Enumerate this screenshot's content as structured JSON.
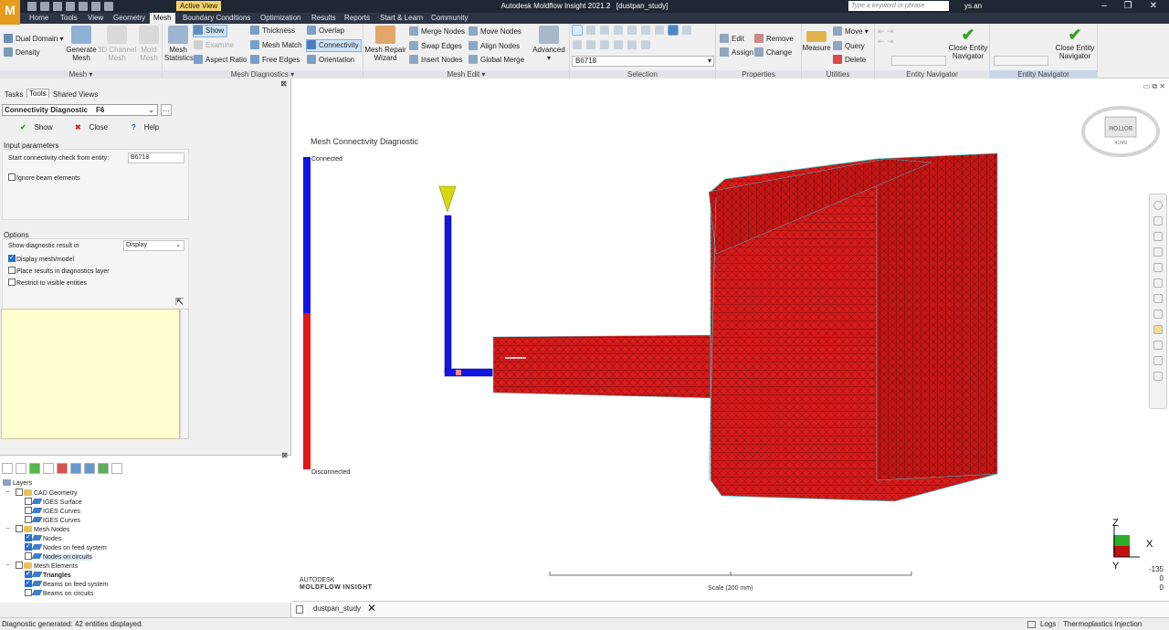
{
  "titlebar": {
    "app_title": "Autodesk Moldflow Insight 2021.2",
    "doc_title": "[dustpan_study]",
    "active_view": "Active View",
    "search_placeholder": "Type a keyword or phrase",
    "user": "ys.an"
  },
  "tabs": [
    "Home",
    "Tools",
    "View",
    "Geometry",
    "Mesh",
    "Boundary Conditions",
    "Optimization",
    "Results",
    "Reports",
    "Start & Learn",
    "Community"
  ],
  "ribbon": {
    "mesh_group": {
      "dual_domain": "Dual Domain",
      "density": "Density",
      "generate_mesh": "Generate Mesh",
      "channel_mesh": "3D Channel Mesh",
      "mold_mesh": "Mold Mesh",
      "label": "Mesh"
    },
    "diag_group": {
      "mesh_statistics": "Mesh Statistics",
      "show": "Show",
      "examine": "Examine",
      "aspect_ratio": "Aspect Ratio",
      "thickness": "Thickness",
      "mesh_match": "Mesh Match",
      "free_edges": "Free Edges",
      "overlap": "Overlap",
      "connectivity": "Connectivity",
      "orientation": "Orientation",
      "label": "Mesh Diagnostics"
    },
    "edit_group": {
      "mesh_repair_wizard": "Mesh Repair Wizard",
      "merge_nodes": "Merge Nodes",
      "swap_edges": "Swap Edges",
      "insert_nodes": "Insert Nodes",
      "move_nodes": "Move Nodes",
      "align_nodes": "Align Nodes",
      "global_merge": "Global Merge",
      "advanced": "Advanced",
      "label": "Mesh Edit"
    },
    "selection_group": {
      "entity_value": "B6718",
      "label": "Selection"
    },
    "properties_group": {
      "edit": "Edit",
      "assign": "Assign",
      "remove": "Remove",
      "change": "Change",
      "label": "Properties"
    },
    "utilities_group": {
      "measure": "Measure",
      "move": "Move",
      "query": "Query",
      "delete": "Delete",
      "label": "Utilities"
    },
    "nav1": {
      "close": "Close Entity Navigator",
      "label": "Entity Navigator"
    },
    "nav2": {
      "close": "Close Entity Navigator",
      "label": "Entity Navigator"
    }
  },
  "left_panel": {
    "tabs": [
      "Tasks",
      "Tools",
      "Shared Views"
    ],
    "tool_name": "Connectivity Diagnostic",
    "tool_key": "F6",
    "show": "Show",
    "close": "Close",
    "help": "Help",
    "input_parameters": "Input parameters",
    "start_from_label": "Start connectivity check from entity:",
    "start_from_value": "B6718",
    "ignore_beams": "Ignore beam elements",
    "options": "Options",
    "show_result_label": "Show diagnostic result in",
    "show_result_value": "Display",
    "display_mesh": "Display mesh/model",
    "place_results": "Place results in diagnostics layer",
    "restrict_visible": "Restrict to visible entities"
  },
  "layers": {
    "root": "Layers",
    "groups": [
      {
        "name": "CAD Geometry",
        "items": [
          {
            "name": "IGES Surface",
            "checked": false
          },
          {
            "name": "IGES Curves",
            "checked": false
          },
          {
            "name": "IGES Curves",
            "checked": false
          }
        ]
      },
      {
        "name": "Mesh Nodes",
        "items": [
          {
            "name": "Nodes",
            "checked": true
          },
          {
            "name": "Nodes on feed system",
            "checked": true
          },
          {
            "name": "Nodes on circuits",
            "checked": false
          }
        ]
      },
      {
        "name": "Mesh Elements",
        "items": [
          {
            "name": "Triangles",
            "checked": true
          },
          {
            "name": "Beams on feed system",
            "checked": true
          },
          {
            "name": "Beams on circuits",
            "checked": false
          }
        ]
      }
    ]
  },
  "viewport": {
    "title": "Mesh Connectivity Diagnostic",
    "legend_top": "Connected",
    "legend_bottom": "Disconnected",
    "connected_color": "#1414e6",
    "disconnected_color": "#e01818",
    "scale_label": "Scale (200 mm)",
    "brand1": "AUTODESK",
    "brand2": "MOLDFLOW INSIGHT",
    "axis_z": "Z",
    "axis_x": "X",
    "axis_y": "Y",
    "view_num1": "-135",
    "view_num2": "0",
    "view_num3": "0",
    "cube_label": "BOTTOM",
    "cube_back": "BACK"
  },
  "doc_tab": "dustpan_study",
  "status": {
    "message": "Diagnostic generated: 42 entities displayed.",
    "logs": "Logs",
    "mode": "Thermoplastics Injection Molding"
  }
}
